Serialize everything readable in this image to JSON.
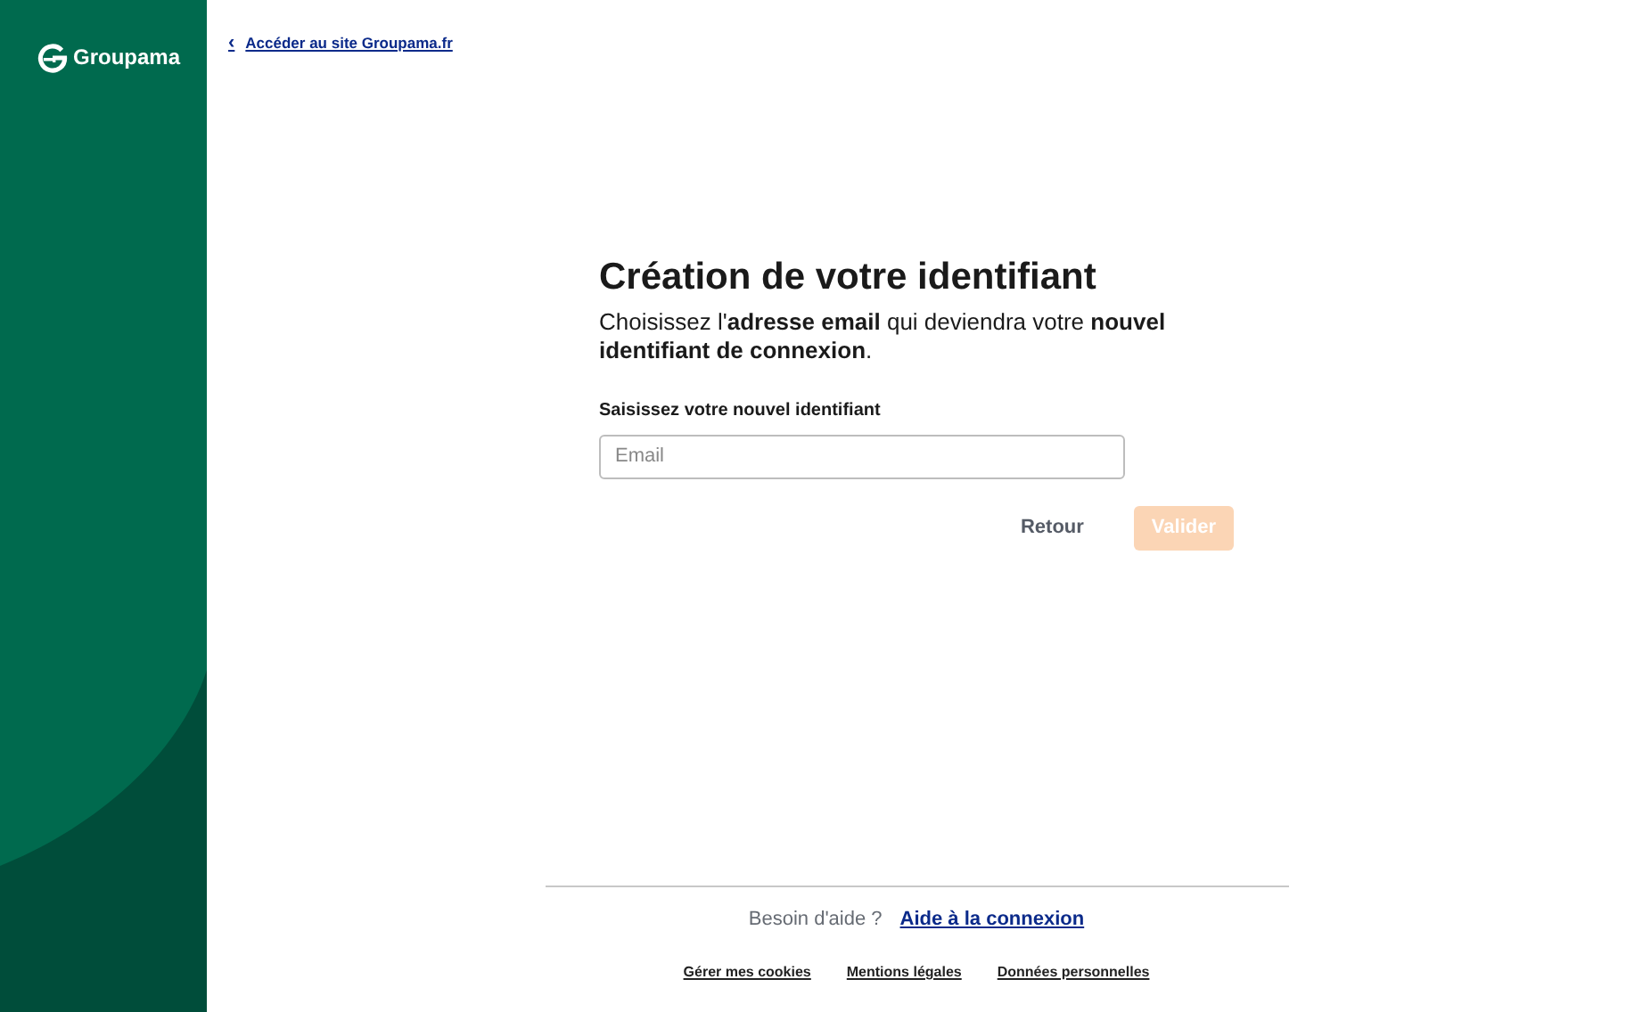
{
  "sidebar": {
    "logo": "Groupama"
  },
  "back_link": {
    "icon": "‹",
    "label": "Accéder au site Groupama.fr"
  },
  "form": {
    "title": "Création de votre identifiant",
    "description": "Choisissez l'**adresse email** qui deviendra votre **nouvel identifiant de connexion**.",
    "field_label": "Saisissez votre nouvel identifiant",
    "email": {
      "placeholder": "Email"
    },
    "buttons": [
      {
        "kind": "secondary",
        "label": "Retour",
        "disabled": false
      },
      {
        "kind": "primary",
        "label": "Valider",
        "disabled": true
      }
    ]
  },
  "footer": {
    "help_text": "Besoin d'aide ?",
    "help_link": "Aide à la connexion",
    "links": [
      "Gérer mes cookies",
      "Mentions légales",
      "Données personnelles"
    ]
  }
}
